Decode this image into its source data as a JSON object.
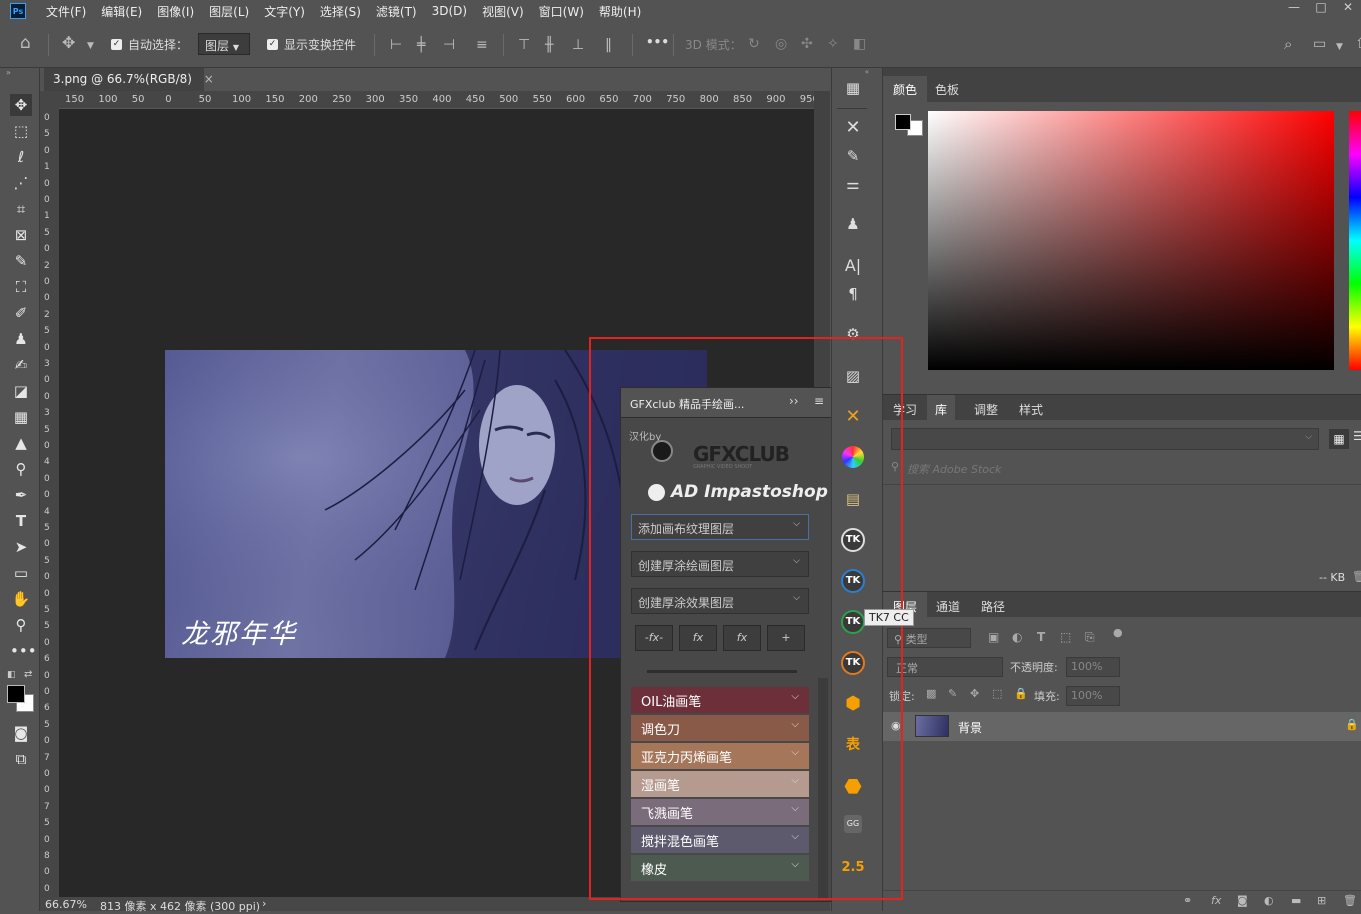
{
  "app": {
    "logo": "Ps"
  },
  "menu": [
    "文件(F)",
    "编辑(E)",
    "图像(I)",
    "图层(L)",
    "文字(Y)",
    "选择(S)",
    "滤镜(T)",
    "3D(D)",
    "视图(V)",
    "窗口(W)",
    "帮助(H)"
  ],
  "window_controls": {
    "minimize": "—",
    "restore": "□",
    "close": "✕"
  },
  "options": {
    "auto_select_label": "自动选择：",
    "auto_select_value": "图层",
    "show_transform_label": "显示变换控件",
    "more": "•••",
    "mode_3d_label": "3D 模式："
  },
  "document": {
    "tab_title": "3.png @ 66.7%(RGB/8)",
    "tab_close": "×",
    "ruler_h": [
      "150",
      "100",
      "50",
      "0",
      "50",
      "100",
      "150",
      "200",
      "250",
      "300",
      "350",
      "400",
      "450",
      "500",
      "550",
      "600",
      "650",
      "700",
      "750",
      "800",
      "850",
      "900",
      "950"
    ],
    "ruler_v": [
      "0",
      "5",
      "0",
      "1",
      "0",
      "0",
      "1",
      "5",
      "0",
      "2",
      "0",
      "0",
      "2",
      "5",
      "0",
      "3",
      "0",
      "0",
      "3",
      "5",
      "0",
      "4",
      "0",
      "0",
      "4",
      "5",
      "0",
      "5",
      "0",
      "0",
      "5",
      "5",
      "0",
      "6",
      "0",
      "0",
      "6",
      "5",
      "0",
      "7",
      "0",
      "0",
      "7",
      "5",
      "0",
      "8",
      "0",
      "0"
    ],
    "photo_caption": "龙邪年华",
    "zoom": "66.67%",
    "size_info": "813 像素 x 462 像素 (300 ppi)",
    "status_arrow": "›"
  },
  "plugin": {
    "title": "GFXclub 精品手绘画...",
    "collapse": "››",
    "menu": "≡",
    "localized_by": "汉化by",
    "brand": "GFXCLUB",
    "brand_sub": "GRAPHIC VIDEO SHOOT",
    "product": "AD Impastoshop",
    "dropdowns": [
      "添加画布纹理图层",
      "创建厚涂绘画图层",
      "创建厚涂效果图层"
    ],
    "fx_buttons": [
      "-fx-",
      "fx",
      "fx",
      "+"
    ],
    "brushes": [
      {
        "label": "OIL油画笔",
        "color": "#6d2f3a"
      },
      {
        "label": "调色刀",
        "color": "#8a5a48"
      },
      {
        "label": "亚克力丙烯画笔",
        "color": "#a5765a"
      },
      {
        "label": "湿画笔",
        "color": "#b59a90"
      },
      {
        "label": "飞溅画笔",
        "color": "#7a6c7a"
      },
      {
        "label": "搅拌混色画笔",
        "color": "#5c5a6c"
      },
      {
        "label": "橡皮",
        "color": "#4d5a50"
      }
    ]
  },
  "dock": {
    "tooltip": "TK7 CC",
    "tk_label": "TK",
    "table_label": "表",
    "gg_label": "GG",
    "version_label": "2.5"
  },
  "panels": {
    "color_tabs": [
      "颜色",
      "色板"
    ],
    "library_tabs": [
      "学习",
      "库",
      "调整",
      "样式"
    ],
    "library_search_placeholder": "搜索 Adobe Stock",
    "library_size": "-- KB",
    "layers_tabs": [
      "图层",
      "通道",
      "路径"
    ],
    "kind_filter": "类型",
    "blend_mode": "正常",
    "opacity_label": "不透明度:",
    "opacity_value": "100%",
    "lock_label": "锁定:",
    "fill_label": "填充:",
    "fill_value": "100%",
    "layer_name": "背景"
  }
}
